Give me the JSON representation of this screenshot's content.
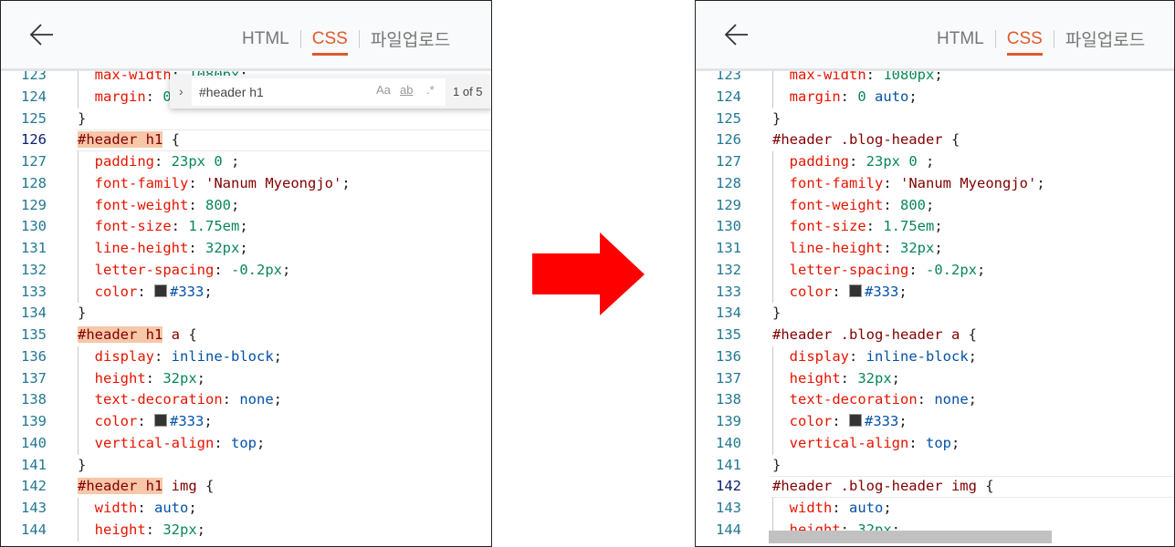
{
  "header": {
    "tabs": [
      {
        "label": "HTML",
        "active": false
      },
      {
        "label": "CSS",
        "active": true
      },
      {
        "label": "파일업로드",
        "active": false
      }
    ]
  },
  "colors": {
    "accent": "#e05a2b",
    "arrow": "#ff0000"
  },
  "find": {
    "value": "#header h1",
    "match_case": "Aa",
    "whole_word": "ab",
    "regex": ".*",
    "count": "1 of 5"
  },
  "left": {
    "current_line": "126",
    "lines": [
      {
        "n": "123",
        "ind": 1,
        "tk": [
          [
            "p",
            "max-width"
          ],
          [
            "t",
            ": "
          ],
          [
            "v",
            "1080px"
          ],
          [
            "t",
            ";"
          ]
        ]
      },
      {
        "n": "124",
        "ind": 1,
        "tk": [
          [
            "p",
            "margin"
          ],
          [
            "t",
            ": "
          ],
          [
            "v",
            "0"
          ],
          [
            "t",
            " "
          ],
          [
            "k",
            "auto"
          ],
          [
            "t",
            ";"
          ]
        ]
      },
      {
        "n": "125",
        "ind": 0,
        "tk": [
          [
            "t",
            "}"
          ]
        ]
      },
      {
        "n": "126",
        "ind": 0,
        "tk": [
          [
            "h",
            "#header h1"
          ],
          [
            "t",
            " {"
          ]
        ]
      },
      {
        "n": "127",
        "ind": 1,
        "tk": [
          [
            "p",
            "padding"
          ],
          [
            "t",
            ": "
          ],
          [
            "v",
            "23px 0"
          ],
          [
            "t",
            " ;"
          ]
        ]
      },
      {
        "n": "128",
        "ind": 1,
        "tk": [
          [
            "p",
            "font-family"
          ],
          [
            "t",
            ": "
          ],
          [
            "s",
            "'Nanum Myeongjo'"
          ],
          [
            "t",
            ";"
          ]
        ]
      },
      {
        "n": "129",
        "ind": 1,
        "tk": [
          [
            "p",
            "font-weight"
          ],
          [
            "t",
            ": "
          ],
          [
            "v",
            "800"
          ],
          [
            "t",
            ";"
          ]
        ]
      },
      {
        "n": "130",
        "ind": 1,
        "tk": [
          [
            "p",
            "font-size"
          ],
          [
            "t",
            ": "
          ],
          [
            "v",
            "1.75em"
          ],
          [
            "t",
            ";"
          ]
        ]
      },
      {
        "n": "131",
        "ind": 1,
        "tk": [
          [
            "p",
            "line-height"
          ],
          [
            "t",
            ": "
          ],
          [
            "v",
            "32px"
          ],
          [
            "t",
            ";"
          ]
        ]
      },
      {
        "n": "132",
        "ind": 1,
        "tk": [
          [
            "p",
            "letter-spacing"
          ],
          [
            "t",
            ": "
          ],
          [
            "v",
            "-0.2px"
          ],
          [
            "t",
            ";"
          ]
        ]
      },
      {
        "n": "133",
        "ind": 1,
        "tk": [
          [
            "p",
            "color"
          ],
          [
            "t",
            ": "
          ],
          [
            "c",
            "#333"
          ],
          [
            "t",
            ";"
          ]
        ]
      },
      {
        "n": "134",
        "ind": 0,
        "tk": [
          [
            "t",
            "}"
          ]
        ]
      },
      {
        "n": "135",
        "ind": 0,
        "tk": [
          [
            "h",
            "#header h1"
          ],
          [
            "s",
            " a"
          ],
          [
            "t",
            " {"
          ]
        ]
      },
      {
        "n": "136",
        "ind": 1,
        "tk": [
          [
            "p",
            "display"
          ],
          [
            "t",
            ": "
          ],
          [
            "k",
            "inline-block"
          ],
          [
            "t",
            ";"
          ]
        ]
      },
      {
        "n": "137",
        "ind": 1,
        "tk": [
          [
            "p",
            "height"
          ],
          [
            "t",
            ": "
          ],
          [
            "v",
            "32px"
          ],
          [
            "t",
            ";"
          ]
        ]
      },
      {
        "n": "138",
        "ind": 1,
        "tk": [
          [
            "p",
            "text-decoration"
          ],
          [
            "t",
            ": "
          ],
          [
            "k",
            "none"
          ],
          [
            "t",
            ";"
          ]
        ]
      },
      {
        "n": "139",
        "ind": 1,
        "tk": [
          [
            "p",
            "color"
          ],
          [
            "t",
            ": "
          ],
          [
            "c",
            "#333"
          ],
          [
            "t",
            ";"
          ]
        ]
      },
      {
        "n": "140",
        "ind": 1,
        "tk": [
          [
            "p",
            "vertical-align"
          ],
          [
            "t",
            ": "
          ],
          [
            "k",
            "top"
          ],
          [
            "t",
            ";"
          ]
        ]
      },
      {
        "n": "141",
        "ind": 0,
        "tk": [
          [
            "t",
            "}"
          ]
        ]
      },
      {
        "n": "142",
        "ind": 0,
        "tk": [
          [
            "h",
            "#header h1"
          ],
          [
            "s",
            " img"
          ],
          [
            "t",
            " {"
          ]
        ]
      },
      {
        "n": "143",
        "ind": 1,
        "tk": [
          [
            "p",
            "width"
          ],
          [
            "t",
            ": "
          ],
          [
            "k",
            "auto"
          ],
          [
            "t",
            ";"
          ]
        ]
      },
      {
        "n": "144",
        "ind": 1,
        "tk": [
          [
            "p",
            "height"
          ],
          [
            "t",
            ": "
          ],
          [
            "v",
            "32px"
          ],
          [
            "t",
            ";"
          ]
        ]
      }
    ]
  },
  "right": {
    "current_line": "142",
    "lines": [
      {
        "n": "123",
        "ind": 1,
        "tk": [
          [
            "p",
            "max-width"
          ],
          [
            "t",
            ": "
          ],
          [
            "v",
            "1080px"
          ],
          [
            "t",
            ";"
          ]
        ]
      },
      {
        "n": "124",
        "ind": 1,
        "tk": [
          [
            "p",
            "margin"
          ],
          [
            "t",
            ": "
          ],
          [
            "v",
            "0"
          ],
          [
            "t",
            " "
          ],
          [
            "k",
            "auto"
          ],
          [
            "t",
            ";"
          ]
        ]
      },
      {
        "n": "125",
        "ind": 0,
        "tk": [
          [
            "t",
            "}"
          ]
        ]
      },
      {
        "n": "126",
        "ind": 0,
        "tk": [
          [
            "s",
            "#header .blog-header"
          ],
          [
            "t",
            " {"
          ]
        ]
      },
      {
        "n": "127",
        "ind": 1,
        "tk": [
          [
            "p",
            "padding"
          ],
          [
            "t",
            ": "
          ],
          [
            "v",
            "23px 0"
          ],
          [
            "t",
            " ;"
          ]
        ]
      },
      {
        "n": "128",
        "ind": 1,
        "tk": [
          [
            "p",
            "font-family"
          ],
          [
            "t",
            ": "
          ],
          [
            "s",
            "'Nanum Myeongjo'"
          ],
          [
            "t",
            ";"
          ]
        ]
      },
      {
        "n": "129",
        "ind": 1,
        "tk": [
          [
            "p",
            "font-weight"
          ],
          [
            "t",
            ": "
          ],
          [
            "v",
            "800"
          ],
          [
            "t",
            ";"
          ]
        ]
      },
      {
        "n": "130",
        "ind": 1,
        "tk": [
          [
            "p",
            "font-size"
          ],
          [
            "t",
            ": "
          ],
          [
            "v",
            "1.75em"
          ],
          [
            "t",
            ";"
          ]
        ]
      },
      {
        "n": "131",
        "ind": 1,
        "tk": [
          [
            "p",
            "line-height"
          ],
          [
            "t",
            ": "
          ],
          [
            "v",
            "32px"
          ],
          [
            "t",
            ";"
          ]
        ]
      },
      {
        "n": "132",
        "ind": 1,
        "tk": [
          [
            "p",
            "letter-spacing"
          ],
          [
            "t",
            ": "
          ],
          [
            "v",
            "-0.2px"
          ],
          [
            "t",
            ";"
          ]
        ]
      },
      {
        "n": "133",
        "ind": 1,
        "tk": [
          [
            "p",
            "color"
          ],
          [
            "t",
            ": "
          ],
          [
            "c",
            "#333"
          ],
          [
            "t",
            ";"
          ]
        ]
      },
      {
        "n": "134",
        "ind": 0,
        "tk": [
          [
            "t",
            "}"
          ]
        ]
      },
      {
        "n": "135",
        "ind": 0,
        "tk": [
          [
            "s",
            "#header .blog-header a"
          ],
          [
            "t",
            " {"
          ]
        ]
      },
      {
        "n": "136",
        "ind": 1,
        "tk": [
          [
            "p",
            "display"
          ],
          [
            "t",
            ": "
          ],
          [
            "k",
            "inline-block"
          ],
          [
            "t",
            ";"
          ]
        ]
      },
      {
        "n": "137",
        "ind": 1,
        "tk": [
          [
            "p",
            "height"
          ],
          [
            "t",
            ": "
          ],
          [
            "v",
            "32px"
          ],
          [
            "t",
            ";"
          ]
        ]
      },
      {
        "n": "138",
        "ind": 1,
        "tk": [
          [
            "p",
            "text-decoration"
          ],
          [
            "t",
            ": "
          ],
          [
            "k",
            "none"
          ],
          [
            "t",
            ";"
          ]
        ]
      },
      {
        "n": "139",
        "ind": 1,
        "tk": [
          [
            "p",
            "color"
          ],
          [
            "t",
            ": "
          ],
          [
            "c",
            "#333"
          ],
          [
            "t",
            ";"
          ]
        ]
      },
      {
        "n": "140",
        "ind": 1,
        "tk": [
          [
            "p",
            "vertical-align"
          ],
          [
            "t",
            ": "
          ],
          [
            "k",
            "top"
          ],
          [
            "t",
            ";"
          ]
        ]
      },
      {
        "n": "141",
        "ind": 0,
        "tk": [
          [
            "t",
            "}"
          ]
        ]
      },
      {
        "n": "142",
        "ind": 0,
        "tk": [
          [
            "s",
            "#header .blog-header img"
          ],
          [
            "t",
            " {"
          ]
        ]
      },
      {
        "n": "143",
        "ind": 1,
        "tk": [
          [
            "p",
            "width"
          ],
          [
            "t",
            ": "
          ],
          [
            "k",
            "auto"
          ],
          [
            "t",
            ";"
          ]
        ]
      },
      {
        "n": "144",
        "ind": 1,
        "tk": [
          [
            "p",
            "height"
          ],
          [
            "t",
            ": "
          ],
          [
            "v",
            "32px"
          ],
          [
            "t",
            ";"
          ]
        ]
      }
    ]
  }
}
